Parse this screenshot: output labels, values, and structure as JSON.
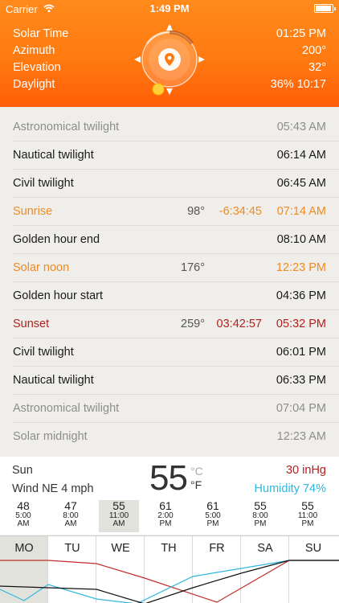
{
  "status_bar": {
    "carrier": "Carrier",
    "time": "1:49 PM"
  },
  "header": {
    "stats": [
      {
        "label": "Solar Time",
        "value": "01:25 PM"
      },
      {
        "label": "Azimuth",
        "value": "200°"
      },
      {
        "label": "Elevation",
        "value": "32°"
      },
      {
        "label": "Daylight",
        "value": "36% 10:17"
      }
    ],
    "compass": {
      "north": "N",
      "azimuth_deg": 200
    }
  },
  "events": [
    {
      "name": "Astronomical twilight",
      "degree": "",
      "duration": "",
      "time": "05:43 AM",
      "style": "dim"
    },
    {
      "name": "Nautical twilight",
      "degree": "",
      "duration": "",
      "time": "06:14 AM",
      "style": "normal"
    },
    {
      "name": "Civil twilight",
      "degree": "",
      "duration": "",
      "time": "06:45 AM",
      "style": "normal"
    },
    {
      "name": "Sunrise",
      "degree": "98°",
      "duration": "-6:34:45",
      "time": "07:14 AM",
      "style": "orange"
    },
    {
      "name": "Golden hour end",
      "degree": "",
      "duration": "",
      "time": "08:10 AM",
      "style": "normal"
    },
    {
      "name": "Solar noon",
      "degree": "176°",
      "duration": "",
      "time": "12:23 PM",
      "style": "orange"
    },
    {
      "name": "Golden hour start",
      "degree": "",
      "duration": "",
      "time": "04:36 PM",
      "style": "normal"
    },
    {
      "name": "Sunset",
      "degree": "259°",
      "duration": "03:42:57",
      "time": "05:32 PM",
      "style": "red"
    },
    {
      "name": "Civil twilight",
      "degree": "",
      "duration": "",
      "time": "06:01 PM",
      "style": "normal"
    },
    {
      "name": "Nautical twilight",
      "degree": "",
      "duration": "",
      "time": "06:33 PM",
      "style": "normal"
    },
    {
      "name": "Astronomical twilight",
      "degree": "",
      "duration": "",
      "time": "07:04 PM",
      "style": "dim"
    },
    {
      "name": "Solar midnight",
      "degree": "",
      "duration": "",
      "time": "12:23 AM",
      "style": "dim"
    }
  ],
  "weather": {
    "day": "Sun",
    "wind": "Wind NE 4 mph",
    "temperature": "55",
    "unit_c": "°C",
    "unit_f": "°F",
    "pressure": "30 inHg",
    "humidity": "Humidity 74%",
    "hourly": [
      {
        "temp": "48",
        "hour": "5:00",
        "ampm": "AM"
      },
      {
        "temp": "47",
        "hour": "8:00",
        "ampm": "AM"
      },
      {
        "temp": "55",
        "hour": "11:00",
        "ampm": "AM"
      },
      {
        "temp": "61",
        "hour": "2:00",
        "ampm": "PM"
      },
      {
        "temp": "61",
        "hour": "5:00",
        "ampm": "PM"
      },
      {
        "temp": "55",
        "hour": "8:00",
        "ampm": "PM"
      },
      {
        "temp": "55",
        "hour": "11:00",
        "ampm": "PM"
      }
    ],
    "selected_hour_index": 2
  },
  "week": {
    "days": [
      "MO",
      "TU",
      "WE",
      "TH",
      "FR",
      "SA",
      "SU"
    ],
    "selected_index": 0,
    "colors": {
      "red": "#c0302a",
      "blue": "#2fb8dc",
      "black": "#111111"
    }
  }
}
